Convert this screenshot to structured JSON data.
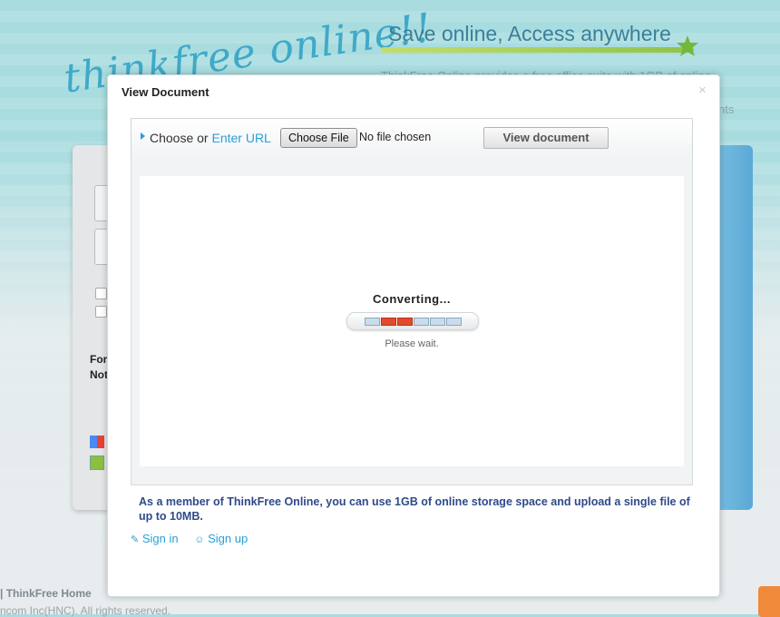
{
  "background": {
    "logo_text": "thinkfree online!!",
    "slogan": "Save online, Access anywhere",
    "intro_text": "ThinkFree Online provides a free office suite with 1GB of online",
    "intro_text_end": "nts",
    "login_links": [
      "For",
      "Not"
    ],
    "footer_link": "| ThinkFree Home",
    "footer_copyright": "ncom Inc(HNC). All rights reserved."
  },
  "modal": {
    "title": "View Document",
    "close_symbol": "×",
    "toolbar": {
      "choose_prefix": "Choose or",
      "enter_url": "Enter URL",
      "choose_file": "Choose File",
      "no_file": "No file chosen",
      "view_document": "View document"
    },
    "status": {
      "title": "Converting...",
      "progress_active_segments": [
        2,
        3
      ],
      "progress_segment_count": 6,
      "message": "Please wait."
    },
    "member_note": "As a member of ThinkFree Online, you can use 1GB of online storage space and upload a single file of up to 10MB.",
    "sign_in": "Sign in",
    "sign_up": "Sign up"
  },
  "colors": {
    "accent": "#2a9fd6",
    "note": "#2e4a8a",
    "progress_active": "#e24a2c"
  }
}
